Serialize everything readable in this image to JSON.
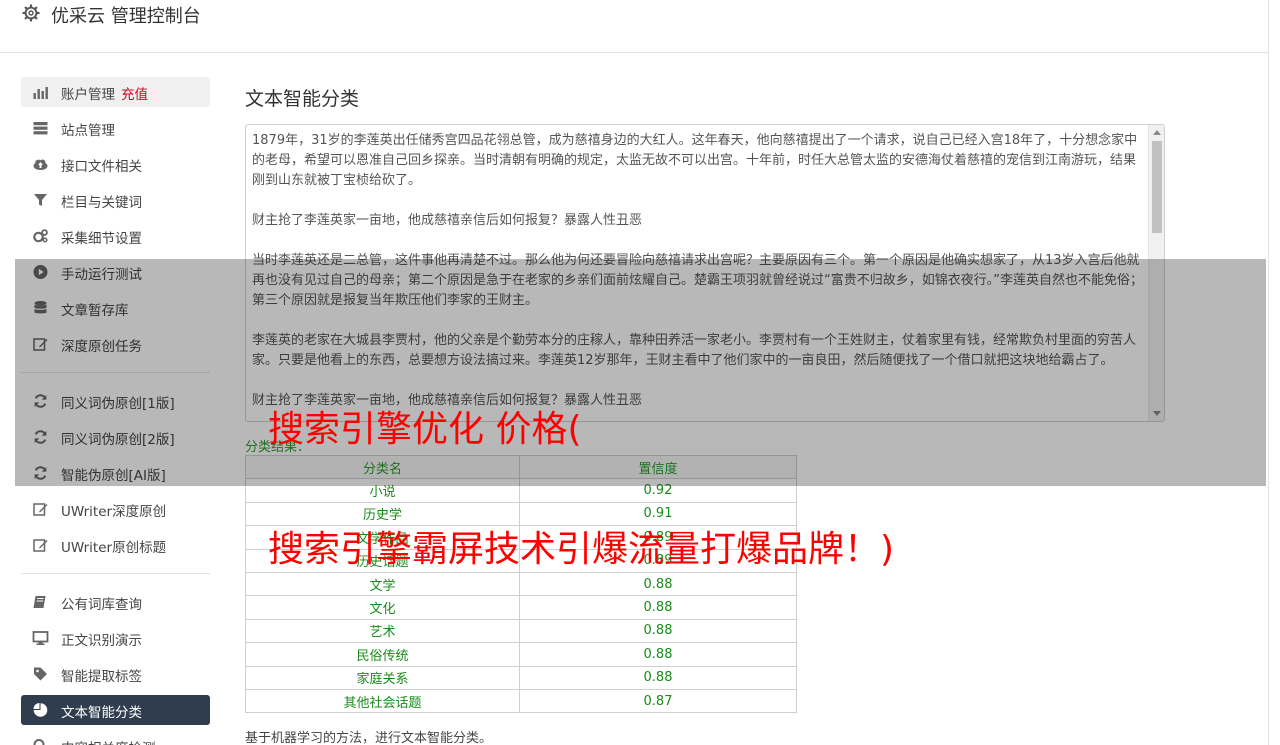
{
  "header": {
    "title": "优采云 管理控制台",
    "icon": "gear-icon"
  },
  "sidebar": {
    "items": [
      {
        "label": "账户管理",
        "extra": "充值",
        "icon": "bar-chart-icon"
      },
      {
        "label": "站点管理",
        "icon": "server-icon"
      },
      {
        "label": "接口文件相关",
        "icon": "cloud-upload-icon"
      },
      {
        "label": "栏目与关键词",
        "icon": "filter-icon"
      },
      {
        "label": "采集细节设置",
        "icon": "cogs-icon"
      },
      {
        "label": "手动运行测试",
        "icon": "play-circle-icon"
      },
      {
        "label": "文章暂存库",
        "icon": "database-icon"
      },
      {
        "label": "深度原创任务",
        "icon": "edit-icon"
      },
      {
        "label": "同义词伪原创[1版]",
        "icon": "refresh-icon"
      },
      {
        "label": "同义词伪原创[2版]",
        "icon": "refresh-icon"
      },
      {
        "label": "智能伪原创[AI版]",
        "icon": "refresh-icon"
      },
      {
        "label": "UWriter深度原创",
        "icon": "edit-icon"
      },
      {
        "label": "UWriter原创标题",
        "icon": "edit-icon"
      },
      {
        "label": "公有词库查询",
        "icon": "book-icon"
      },
      {
        "label": "正文识别演示",
        "icon": "monitor-icon"
      },
      {
        "label": "智能提取标签",
        "icon": "tag-icon"
      },
      {
        "label": "文本智能分类",
        "icon": "pie-chart-icon"
      },
      {
        "label": "内容相关度检测",
        "icon": "search-icon"
      }
    ]
  },
  "main": {
    "title": "文本智能分类",
    "article": [
      "1879年，31岁的李莲英出任储秀宫四品花翎总管，成为慈禧身边的大红人。这年春天，他向慈禧提出了一个请求，说自己已经入宫18年了，十分想念家中的老母，希望可以恩准自己回乡探亲。当时清朝有明确的规定，太监无故不可以出宫。十年前，时任大总管太监的安德海仗着慈禧的宠信到江南游玩，结果刚到山东就被丁宝桢给砍了。",
      "财主抢了李莲英家一亩地，他成慈禧亲信后如何报复？暴露人性丑恶",
      "当时李莲英还是二总管，这件事他再清楚不过。那么他为何还要冒险向慈禧请求出宫呢？主要原因有三个。第一个原因是他确实想家了，从13岁入宫后他就再也没有见过自己的母亲；第二个原因是急于在老家的乡亲们面前炫耀自己。楚霸王项羽就曾经说过“富贵不归故乡，如锦衣夜行。”李莲英自然也不能免俗；第三个原因就是报复当年欺压他们李家的王财主。",
      "李莲英的老家在大城县李贾村，他的父亲是个勤劳本分的庄稼人，靠种田养活一家老小。李贾村有一个王姓财主，仗着家里有钱，经常欺负村里面的穷苦人家。只要是他看上的东西，总要想方设法搞过来。李莲英12岁那年，王财主看中了他们家中的一亩良田，然后随便找了一个借口就把这块地给霸占了。",
      "财主抢了李莲英家一亩地，他成慈禧亲信后如何报复？暴露人性丑恶"
    ],
    "result_label": "分类结果：",
    "table": {
      "headers": [
        "分类名",
        "置信度"
      ],
      "rows": [
        [
          "小说",
          "0.92"
        ],
        [
          "历史学",
          "0.91"
        ],
        [
          "文学作品",
          "0.89"
        ],
        [
          "历史话题",
          "0.89"
        ],
        [
          "文学",
          "0.88"
        ],
        [
          "文化",
          "0.88"
        ],
        [
          "艺术",
          "0.88"
        ],
        [
          "民俗传统",
          "0.88"
        ],
        [
          "家庭关系",
          "0.88"
        ],
        [
          "其他社会话题",
          "0.87"
        ]
      ]
    },
    "footnote": "基于机器学习的方法，进行文本智能分类。"
  },
  "overlay": {
    "line1": "搜索引擎优化 价格(",
    "line2": "搜索引擎霸屏技术引爆流量打爆品牌！)"
  },
  "colors": {
    "active_bg": "#2f3d4e",
    "result_green": "#2e9a2e",
    "overlay_red": "#ff0000",
    "recharge_red": "#d0021b"
  }
}
